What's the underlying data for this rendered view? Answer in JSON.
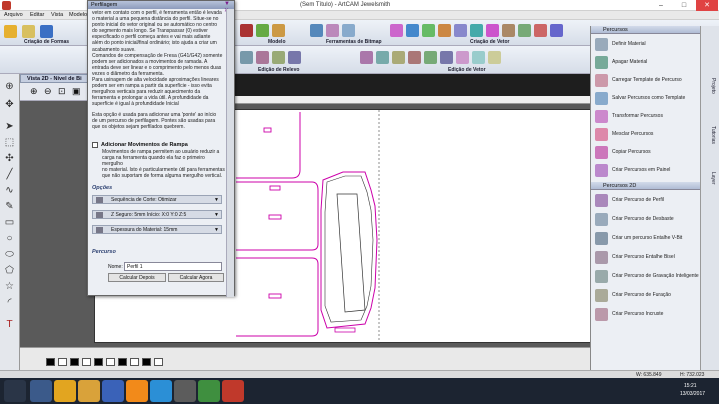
{
  "window": {
    "title": "(Sem Título) - ArtCAM Jewelsmith",
    "min": "–",
    "max": "□",
    "close": "✕"
  },
  "menu": [
    "Arquivo",
    "Editar",
    "Vista",
    "Modelo"
  ],
  "toolbar": {
    "group_criacao": "Criação de Formas",
    "group_modelo": "Modelo",
    "group_ferramentas": "Ferramentas de Bitmap",
    "group_criacao_vetor": "Criação de Vetor",
    "group_relevo": "Edição de Relevo",
    "group_edicao_vetor": "Edição de Vetor"
  },
  "view_tab": "Vista 2D - Nível de Bi",
  "panel": {
    "title": "Perfilagem",
    "intro": [
      "vetor em contato com o perfil, é ferramenta então é levada",
      "o material a uma pequena distância do perfil. Situe-se no",
      "ponto inicial do vetor original ou se automático no centro",
      "do segmento mais longo. Se Transpassar (0) estiver",
      "especificado o perfil começa antes e vai mais adiante",
      "além do ponto inicial/final ordinário; isto ajuda a criar um",
      "acabamento suave.",
      "Comandos de compensação de Fresa (G41/G42) somente",
      "podem ser adicionados a movimentos de ramada. A",
      "entrada deve ser linear e o comprimento pelo menos duas",
      "vezes o diâmetro da ferramenta.",
      "Para usinagem de alta velocidade aproximações lineares",
      "podem ser em rampa a partir da superfície - isso evita",
      "mergulhos verticais para reduzir aquecimento da",
      "ferramenta e prolongar a vida útil. A profundidade da",
      "superfície é igual à profundidade Inicial"
    ],
    "note": [
      "Esta opção é usada para adicionar uma 'ponte' ao início",
      "de um percurso de perfilagem. Pontes são usadas para",
      "que os objetos sejam perfilados quebrem."
    ],
    "ramp_checkbox": "Adicionar Movimentos de Rampa",
    "ramp_text": [
      "Movimentos de rampa permitem ao usuário reduzir a",
      "carga na ferramenta quando ela faz o primeiro mergulho",
      "no material. Isto é particularmente útil para ferramentas",
      "que não suportam de forma alguma mergulho vertical."
    ],
    "opcoes_header": "Opções",
    "sequence": "Sequência de Corte: Otimizar",
    "safe_z": "Z Seguro: 5mm  Início: X:0 Y:0 Z:5",
    "material": "Espessura do Material: 15mm",
    "percurso_header": "Percurso",
    "name_label": "Nome:",
    "name_value": "Perfil 1",
    "btn_later": "Calcular Depois",
    "btn_now": "Calcular Agora"
  },
  "right_panel": {
    "header1": "Percursos",
    "items1": [
      "Definir Material",
      "Apagar Material",
      "Carregar Template de Percurso",
      "Salvar Percursos como Template",
      "Transformar Percursos",
      "Mesclar Percursos",
      "Copiar Percursos",
      "Criar Percursos em Painel"
    ],
    "header2": "Percursos 2D",
    "items2": [
      "Criar Percurso de Perfil",
      "Criar Percurso de Desbaste",
      "Criar um percurso Entalhe V-Bit",
      "Criar Percurso Entalhe Bisel",
      "Criar Percurso de Gravação Inteligente",
      "Criar Percurso de Furação",
      "Criar Percurso Incruste"
    ],
    "side_tabs": [
      "Projeto",
      "Tutorias",
      "Layer"
    ]
  },
  "status": {
    "w": "W: 635.849",
    "h": "H: 732.023"
  },
  "clock": {
    "time": "15:21",
    "date": "13/03/2017"
  },
  "colors": {
    "accent": "#cc00aa",
    "panel_header": "#8d9cbc"
  }
}
